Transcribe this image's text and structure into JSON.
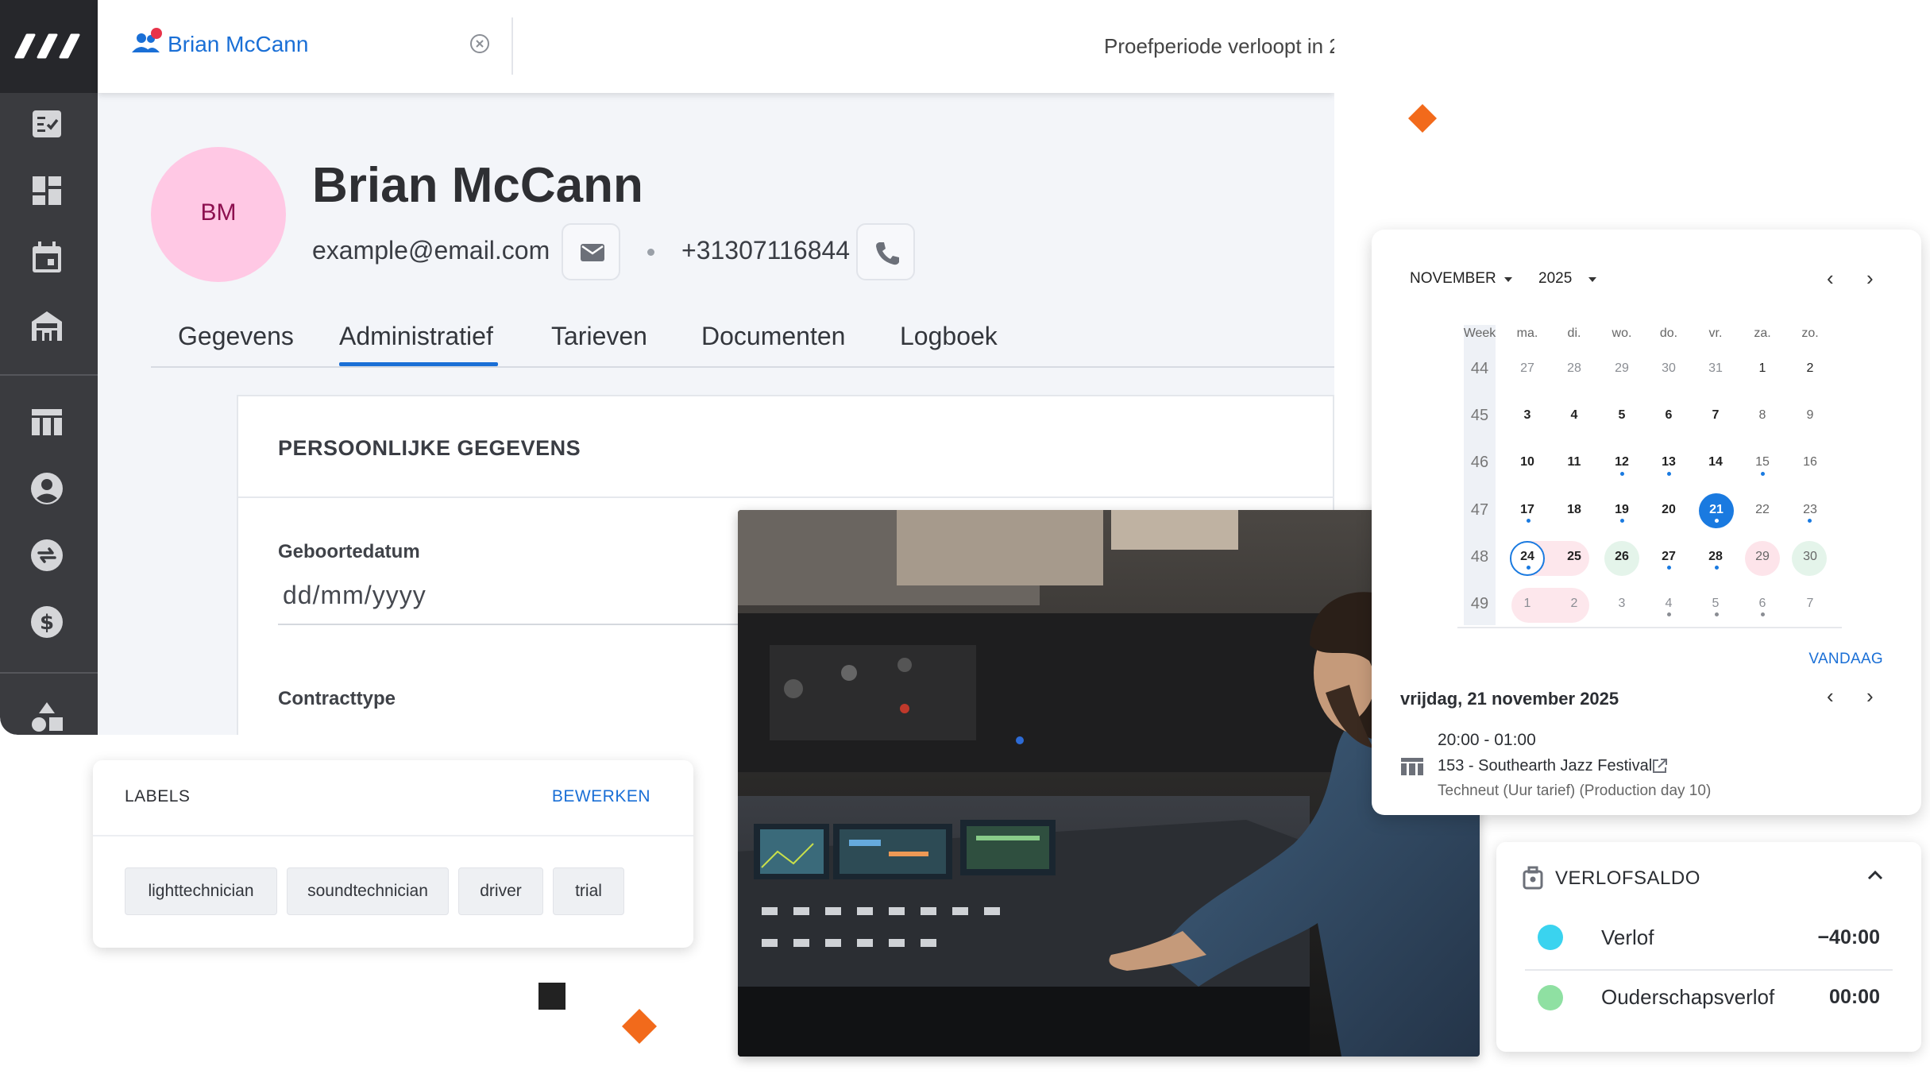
{
  "app": {
    "tab_user_name": "Brian McCann",
    "trial_text": "Proefperiode verloopt in 2",
    "sidebar_icons": [
      "tasks-icon",
      "dashboard-icon",
      "calendar-icon",
      "venue-icon",
      "table-icon",
      "user-icon",
      "transfer-icon",
      "dollar-icon",
      "shapes-icon"
    ]
  },
  "profile": {
    "initials": "BM",
    "name": "Brian McCann",
    "email": "example@email.com",
    "phone": "+31307116844",
    "avatar_color": "#ffc8e4"
  },
  "tabs": [
    {
      "label": "Gegevens"
    },
    {
      "label": "Administratief",
      "active": true
    },
    {
      "label": "Tarieven"
    },
    {
      "label": "Documenten"
    },
    {
      "label": "Logboek"
    }
  ],
  "personal": {
    "title": "PERSOONLIJKE GEGEVENS",
    "birthdate_label": "Geboortedatum",
    "birthdate_placeholder": "dd/mm/yyyy",
    "contract_label": "Contracttype"
  },
  "labels_card": {
    "title": "LABELS",
    "edit": "BEWERKEN",
    "chips": [
      "lighttechnician",
      "soundtechnician",
      "driver",
      "trial"
    ]
  },
  "calendar": {
    "month": "NOVEMBER",
    "year": "2025",
    "headers": [
      "Week",
      "ma.",
      "di.",
      "wo.",
      "do.",
      "vr.",
      "za.",
      "zo."
    ],
    "weeks": [
      {
        "week": "44",
        "days": [
          "27",
          "28",
          "29",
          "30",
          "31",
          "1",
          "2"
        ]
      },
      {
        "week": "45",
        "days": [
          "3",
          "4",
          "5",
          "6",
          "7",
          "8",
          "9"
        ]
      },
      {
        "week": "46",
        "days": [
          "10",
          "11",
          "12",
          "13",
          "14",
          "15",
          "16"
        ]
      },
      {
        "week": "47",
        "days": [
          "17",
          "18",
          "19",
          "20",
          "21",
          "22",
          "23"
        ]
      },
      {
        "week": "48",
        "days": [
          "24",
          "25",
          "26",
          "27",
          "28",
          "29",
          "30"
        ]
      },
      {
        "week": "49",
        "days": [
          "1",
          "2",
          "3",
          "4",
          "5",
          "6",
          "7"
        ]
      }
    ],
    "selected_day": "21",
    "today_label": "VANDAAG",
    "selected_date_text": "vrijdag, 21 november 2025",
    "event": {
      "time": "20:00 - 01:00",
      "title": "153 - Southearth Jazz Festival",
      "subtitle": "Techneut (Uur tarief) (Production day 10)"
    },
    "accent": "#1a7ae0"
  },
  "verlofsaldo": {
    "title": "VERLOFSALDO",
    "rows": [
      {
        "label": "Verlof",
        "value": "−40:00",
        "color": "#3ad3ef"
      },
      {
        "label": "Ouderschapsverlof",
        "value": "00:00",
        "color": "#8fe0a2"
      }
    ]
  },
  "colors": {
    "primary": "#1a6fd6",
    "sidebar": "#3a3b3f",
    "accent_orange": "#f26a1b"
  }
}
